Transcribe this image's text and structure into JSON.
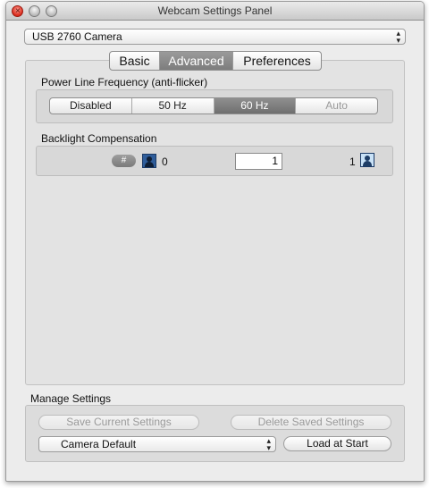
{
  "window": {
    "title": "Webcam Settings Panel"
  },
  "camera_select": {
    "selected": "USB 2760 Camera",
    "arrows_icon": "updown-arrows-icon"
  },
  "tabs": [
    {
      "label": "Basic",
      "selected": false
    },
    {
      "label": "Advanced",
      "selected": true
    },
    {
      "label": "Preferences",
      "selected": false
    }
  ],
  "power_line": {
    "label": "Power Line Frequency (anti-flicker)",
    "options": [
      {
        "label": "Disabled",
        "state": "normal"
      },
      {
        "label": "50 Hz",
        "state": "normal"
      },
      {
        "label": "60 Hz",
        "state": "selected"
      },
      {
        "label": "Auto",
        "state": "disabled"
      }
    ]
  },
  "backlight": {
    "label": "Backlight Compensation",
    "hash_button": "#",
    "min_label": "0",
    "value": "1",
    "max_label": "1",
    "min_icon": "backlight-low-icon",
    "max_icon": "backlight-high-icon"
  },
  "manage": {
    "label": "Manage Settings",
    "save_button": "Save Current Settings",
    "delete_button": "Delete Saved Settings",
    "preset_select": "Camera Default",
    "load_button": "Load at Start"
  },
  "colors": {
    "window_bg": "#ececec",
    "selected_segment": "#7d7d7d",
    "close_light": "#d92a1c"
  }
}
